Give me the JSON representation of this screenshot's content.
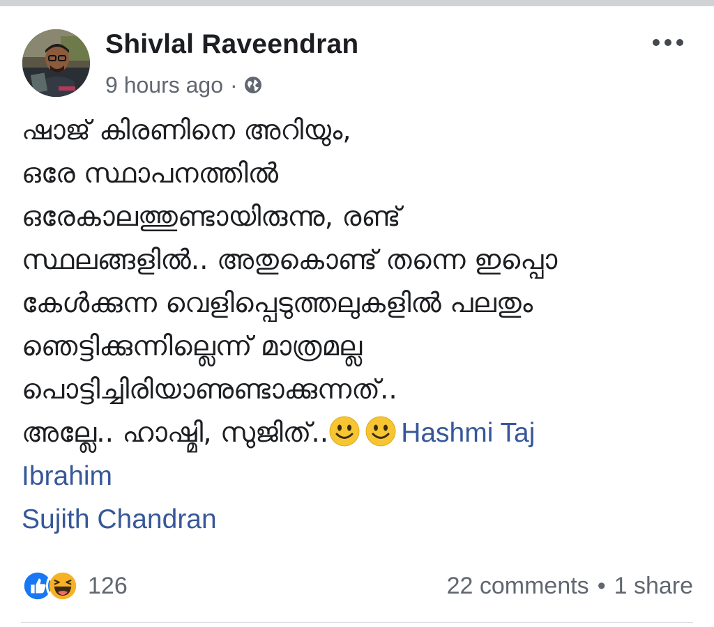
{
  "post": {
    "author": "Shivlal Raveendran",
    "time": "9 hours ago",
    "separator": "·",
    "text_lines": [
      "ഷാജ് കിരണിനെ അറിയും,",
      "ഒരേ സ്ഥാപനത്തിൽ",
      "ഒരേകാലത്തുണ്ടായിരുന്നു, രണ്ട്",
      "സ്ഥലങ്ങളിൽ.. അതുകൊണ്ട് തന്നെ ഇപ്പൊ",
      "കേൾക്കുന്ന വെളിപ്പെടുത്തലുകളിൽ പലതും",
      "ഞെട്ടിക്കുന്നില്ലെന്ന് മാത്രമല്ല",
      "പൊട്ടിച്ചിരിയാണുണ്ടാക്കുന്നത്..",
      "അല്ലേ.. ഹാഷ്മി, സുജിത്.."
    ],
    "mentions": [
      "Hashmi Taj",
      "Ibrahim",
      "Sujith Chandran"
    ],
    "icons": {
      "avatar": "profile-photo",
      "privacy": "globe-icon",
      "more": "more-options-icon",
      "emoji": "smiley-emoji-icon",
      "like": "like-reaction-icon",
      "haha": "haha-reaction-icon"
    }
  },
  "footer": {
    "reaction_count": "126",
    "comments": "22 comments",
    "dot": "•",
    "shares": "1 share"
  },
  "colors": {
    "mention": "#365899",
    "meta": "#606770",
    "like": "#1877f2",
    "haha": "#f7b125"
  }
}
